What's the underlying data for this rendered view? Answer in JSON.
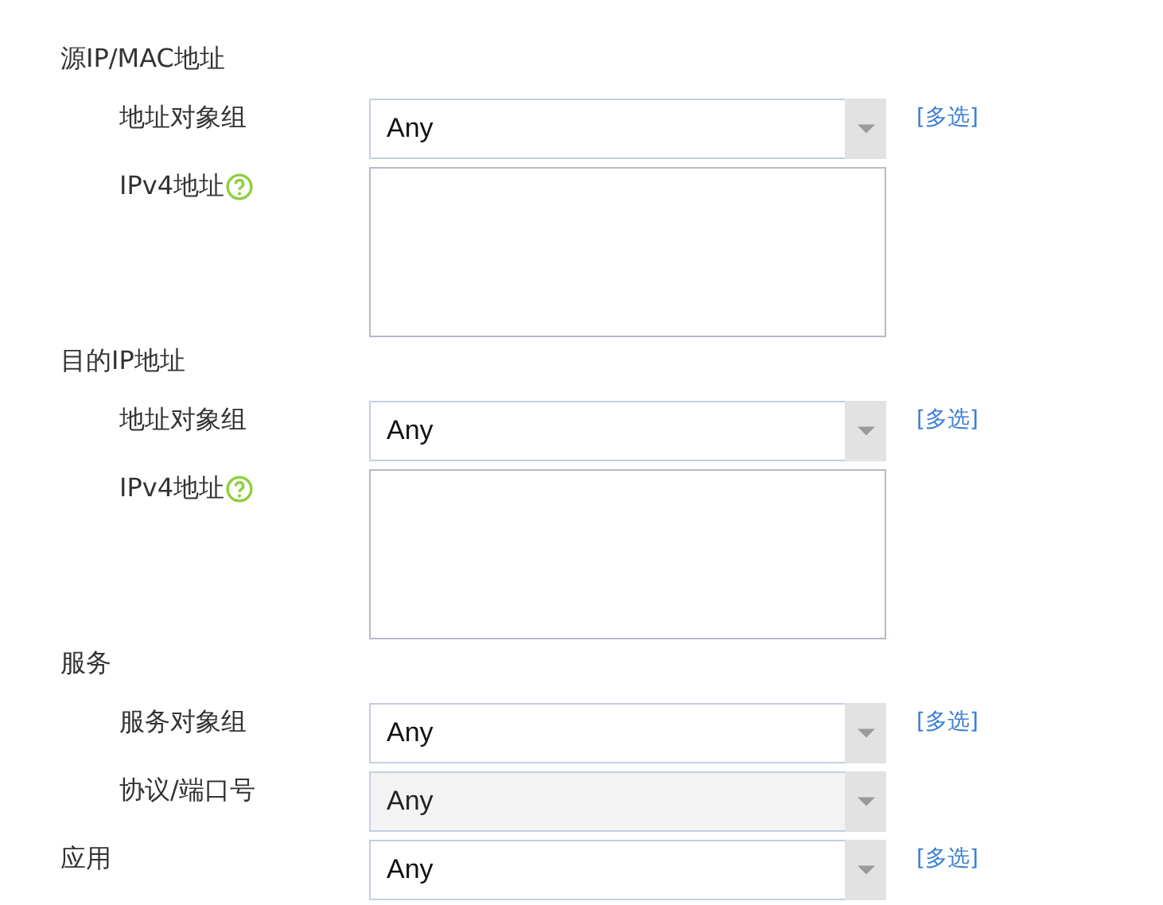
{
  "rows": [
    {
      "kind": "heading",
      "label": "源IP/MAC地址"
    },
    {
      "kind": "select",
      "sub": true,
      "label": "地址对象组",
      "value": "Any",
      "disabled": false,
      "link": "[多选]"
    },
    {
      "kind": "textarea",
      "sub": true,
      "label": "IPv4地址",
      "help": true
    },
    {
      "kind": "heading",
      "label": "目的IP地址"
    },
    {
      "kind": "select",
      "sub": true,
      "label": "地址对象组",
      "value": "Any",
      "disabled": false,
      "link": "[多选]"
    },
    {
      "kind": "textarea",
      "sub": true,
      "label": "IPv4地址",
      "help": true
    },
    {
      "kind": "heading",
      "label": "服务"
    },
    {
      "kind": "select",
      "sub": true,
      "label": "服务对象组",
      "value": "Any",
      "disabled": false,
      "link": "[多选]"
    },
    {
      "kind": "select",
      "sub": true,
      "label": "协议/端口号",
      "value": "Any",
      "disabled": true
    },
    {
      "kind": "select",
      "sub": false,
      "label": "应用",
      "value": "Any",
      "disabled": false,
      "link": "[多选]"
    }
  ]
}
